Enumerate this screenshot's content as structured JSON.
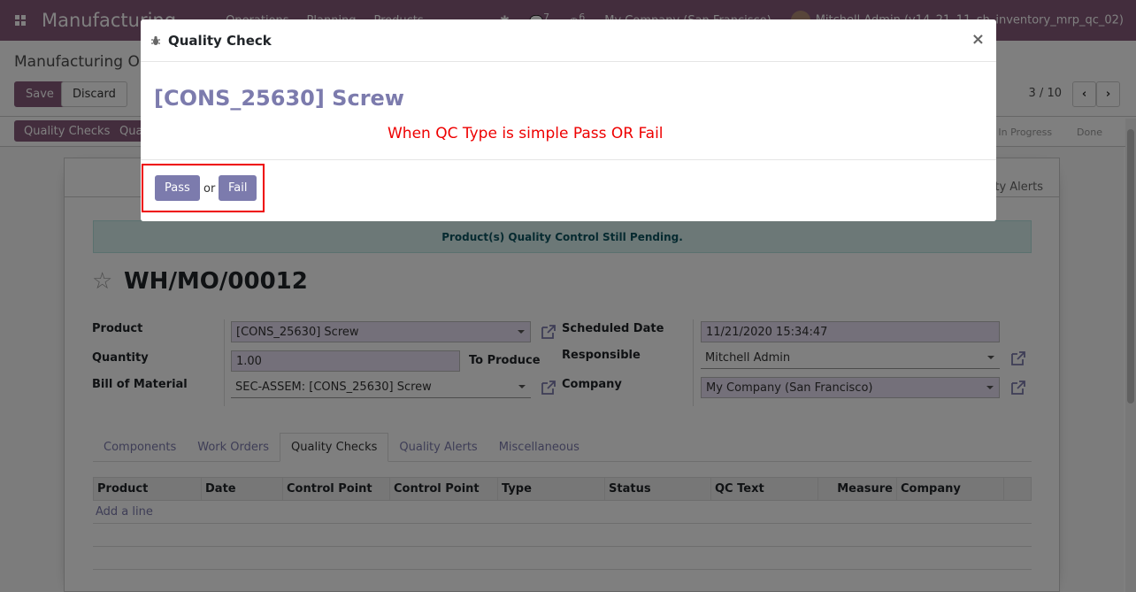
{
  "topbar": {
    "app_title": "Manufacturing",
    "menu": [
      "Operations",
      "Planning",
      "Products"
    ],
    "chat_badge": "7",
    "activity_badge": "6",
    "company": "My Company (San Francisco)",
    "user": "Mitchell Admin (v14_21_11_sh_inventory_mrp_qc_02)"
  },
  "control_panel": {
    "breadcrumb": "Manufacturing Orders",
    "save_label": "Save",
    "discard_label": "Discard",
    "pager": "3 / 10"
  },
  "statusbar": {
    "quality_checks_label": "Quality Checks",
    "second_button_label": "Quality Alert",
    "stages": [
      "In Progress",
      "Done"
    ]
  },
  "form": {
    "smart_button": "Quality Alerts",
    "alert_text": "Product(s) Quality Control Still Pending.",
    "title": "WH/MO/00012",
    "labels": {
      "product": "Product",
      "quantity": "Quantity",
      "bom": "Bill of Material",
      "to_produce": "To Produce",
      "scheduled_date": "Scheduled Date",
      "responsible": "Responsible",
      "company": "Company"
    },
    "values": {
      "product": "[CONS_25630] Screw",
      "quantity": "1.00",
      "bom": "SEC-ASSEM: [CONS_25630] Screw",
      "scheduled_date": "11/21/2020 15:34:47",
      "responsible": "Mitchell Admin",
      "company": "My Company (San Francisco)"
    },
    "tabs": [
      "Components",
      "Work Orders",
      "Quality Checks",
      "Quality Alerts",
      "Miscellaneous"
    ],
    "active_tab": "Quality Checks",
    "table_columns": [
      "Product",
      "Date",
      "Control Point",
      "Control Point",
      "Type",
      "Status",
      "QC Text",
      "Measure",
      "Company"
    ],
    "add_line": "Add a line"
  },
  "modal": {
    "title": "Quality Check",
    "product_heading": "[CONS_25630] Screw",
    "annotation": "When QC Type is simple Pass OR Fail",
    "pass_label": "Pass",
    "or_label": "or",
    "fail_label": "Fail",
    "close_label": "×"
  },
  "colors": {
    "brand": "#875a7b",
    "accent": "#7c7bad",
    "annotation": "#ee0000"
  }
}
